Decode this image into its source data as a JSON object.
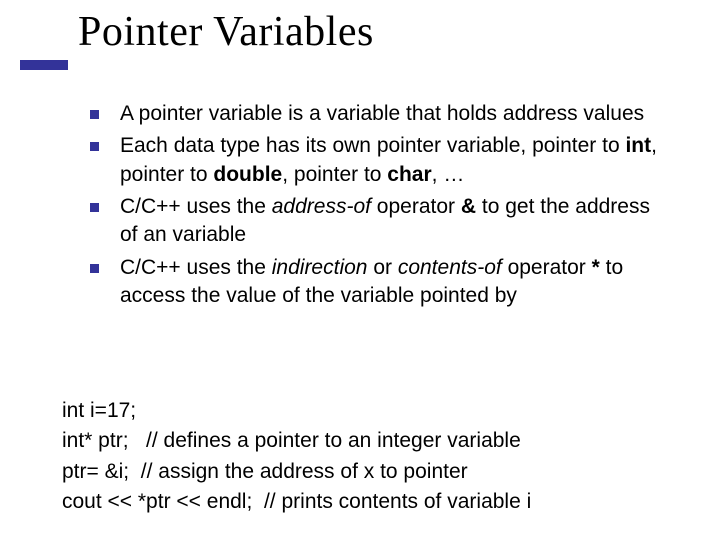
{
  "title": "Pointer Variables",
  "bullets": [
    {
      "segments": [
        {
          "text": "A pointer variable is a variable that holds address values"
        }
      ]
    },
    {
      "segments": [
        {
          "text": "Each data type has its own pointer variable, pointer to "
        },
        {
          "text": "int",
          "bold": true
        },
        {
          "text": ", pointer to "
        },
        {
          "text": "double",
          "bold": true
        },
        {
          "text": ", pointer to "
        },
        {
          "text": "char",
          "bold": true
        },
        {
          "text": ", …"
        }
      ]
    },
    {
      "segments": [
        {
          "text": "C/C++ uses the "
        },
        {
          "text": "address-of",
          "italic": true
        },
        {
          "text": " operator "
        },
        {
          "text": "&",
          "bold": true
        },
        {
          "text": " to get the address of an variable"
        }
      ]
    },
    {
      "segments": [
        {
          "text": "C/C++ uses the "
        },
        {
          "text": "indirection",
          "italic": true
        },
        {
          "text": " or "
        },
        {
          "text": "contents-of ",
          "italic": true
        },
        {
          "text": " operator "
        },
        {
          "text": "*",
          "bold": true
        },
        {
          "text": " to access the value of the variable pointed by"
        }
      ]
    }
  ],
  "code": [
    "int i=17;",
    "int* ptr;   // defines a pointer to an integer variable",
    "ptr= &i;  // assign the address of x to pointer",
    "cout << *ptr << endl;  // prints contents of variable i"
  ]
}
